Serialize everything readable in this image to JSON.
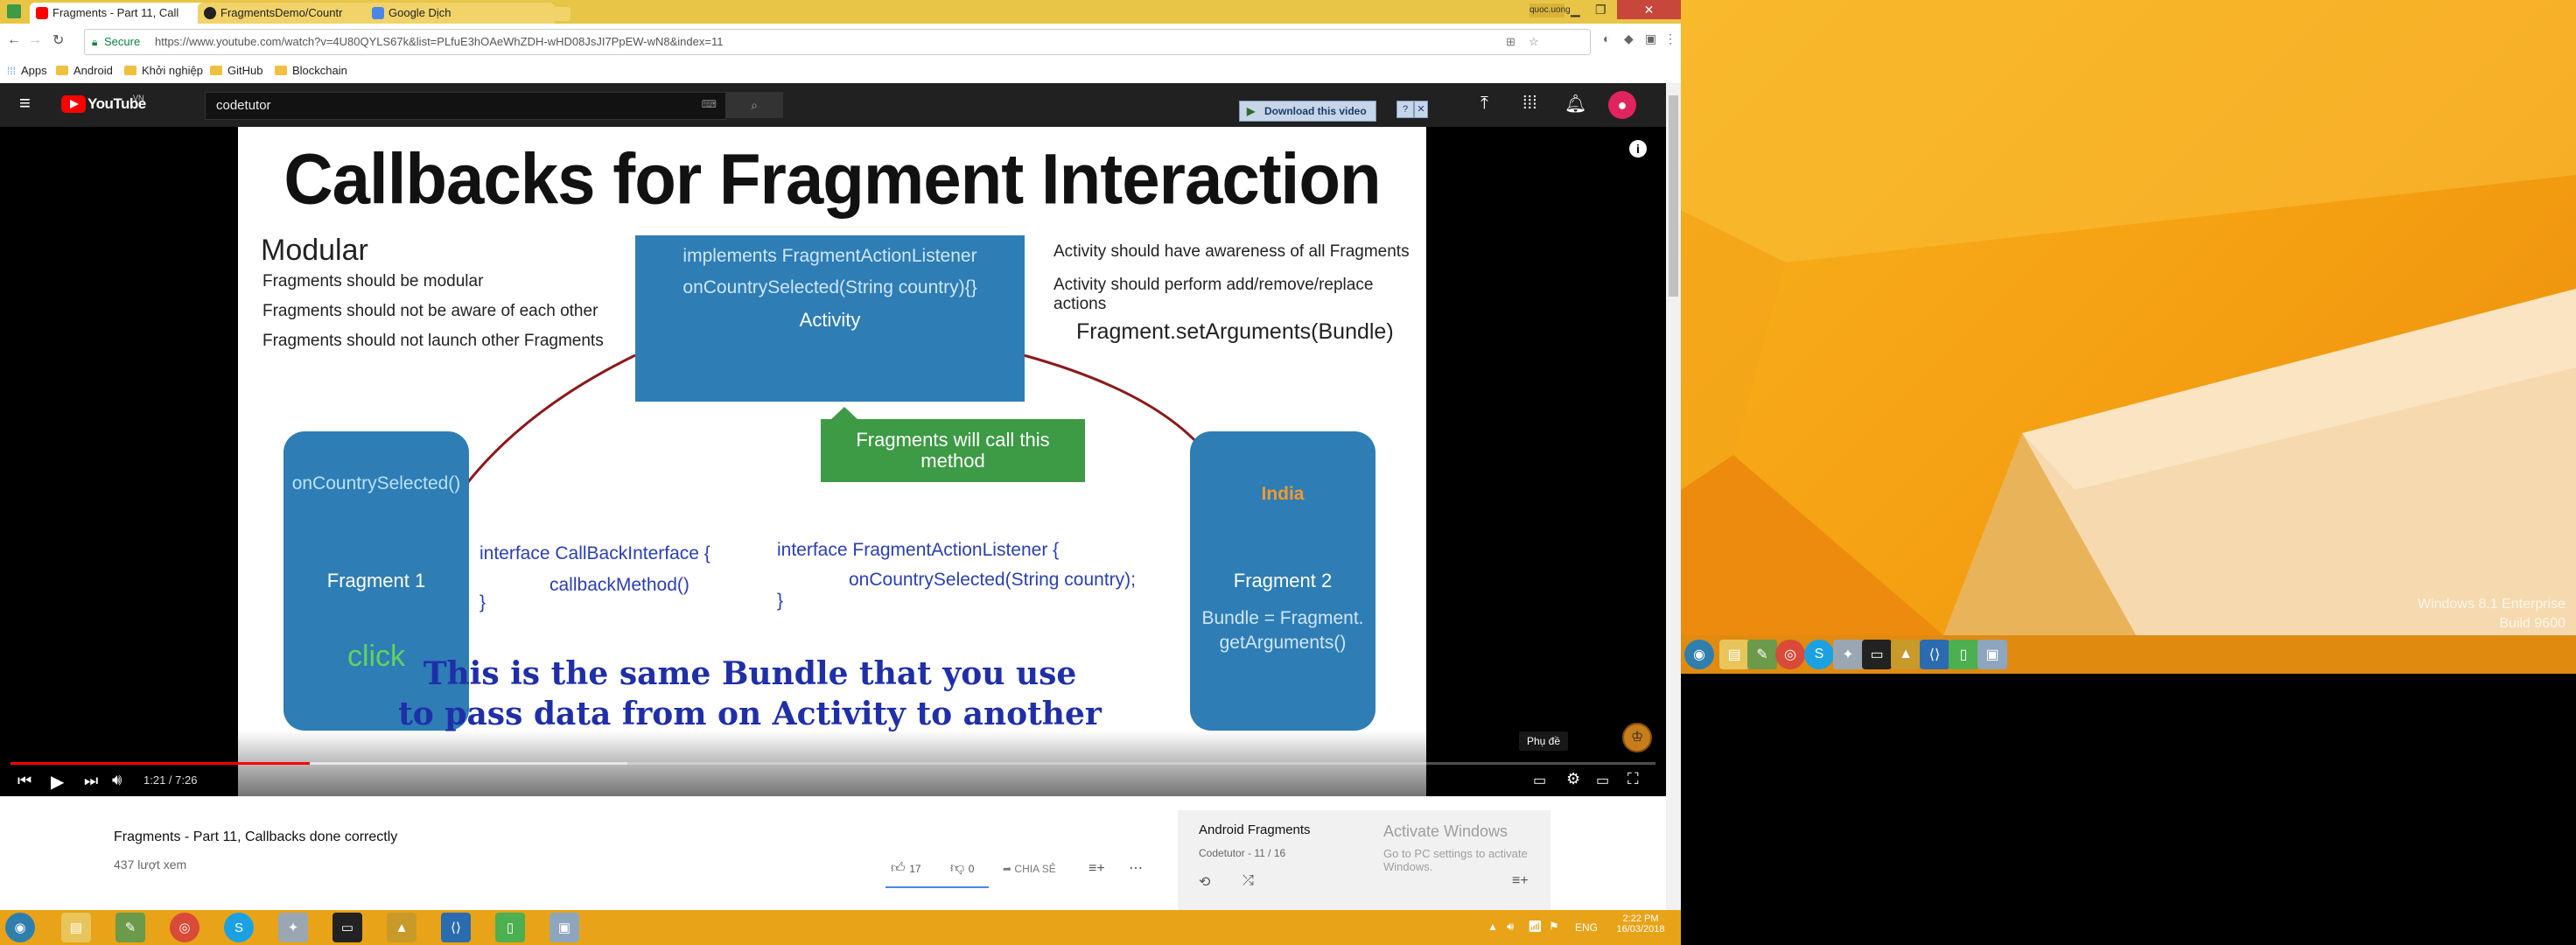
{
  "tabs": [
    {
      "title": "Fragments - Part 11, Call",
      "active": true,
      "icon": "youtube-icon"
    },
    {
      "title": "FragmentsDemo/Countr",
      "active": false,
      "icon": "github-icon"
    },
    {
      "title": "Google Dịch",
      "active": false,
      "icon": "translate-icon"
    }
  ],
  "window_user": "quoc.uong",
  "address": {
    "secure_label": "Secure",
    "url": "https://www.youtube.com/watch?v=4U80QYLS67k&list=PLfuE3hOAeWhZDH-wHD08JsJI7PpEW-wN8&index=11"
  },
  "bookmarks": [
    "Apps",
    "Android",
    "Khởi nghiệp",
    "GitHub",
    "Blockchain"
  ],
  "youtube": {
    "logo": "YouTube",
    "region": "VN",
    "search_value": "codetutor",
    "download_label": "Download this video",
    "video": {
      "time_current": "1:21",
      "time_total": "7:26",
      "progress": 0.182,
      "buffered": 0.375,
      "subtitle_label": "Phụ đề",
      "title": "Fragments - Part 11, Callbacks done correctly",
      "views": "437 lượt xem",
      "likes": "17",
      "dislikes": "0",
      "share_label": "CHIA SẺ"
    },
    "playlist": {
      "title": "Android Fragments",
      "meta": "Codetutor - 11 / 16"
    },
    "activation": {
      "title": "Activate Windows",
      "subtitle": "Go to PC settings to activate Windows."
    }
  },
  "slide": {
    "title": "Callbacks for Fragment Interaction",
    "modular_heading": "Modular",
    "modular_points": [
      "Fragments should be modular",
      "Fragments should not be aware of each other",
      "Fragments should not launch other Fragments"
    ],
    "activity_box": [
      "implements FragmentActionListener",
      "onCountrySelected(String country){}",
      "Activity"
    ],
    "activity_points": [
      "Activity should have awareness of  all Fragments",
      "Activity should perform add/remove/replace actions"
    ],
    "set_arguments": "Fragment.setArguments(Bundle)",
    "callout": "Fragments will call this method",
    "fragment1": {
      "method": "onCountrySelected()",
      "name": "Fragment 1",
      "click": "click"
    },
    "fragment2": {
      "country": "India",
      "name": "Fragment 2",
      "bundle": "Bundle = Fragment. getArguments()"
    },
    "interface1": [
      "interface CallBackInterface {",
      "callbackMethod()",
      "}"
    ],
    "interface2": [
      "interface FragmentActionListener {",
      "onCountrySelected(String country);",
      "}"
    ],
    "bundle_note": [
      "This is the same Bundle that you use",
      "to pass data from on Activity to another"
    ]
  },
  "desktop": {
    "watermark_line1": "Windows 8.1 Enterprise",
    "watermark_line2": "Build 9600"
  },
  "taskbar": {
    "lang": "ENG",
    "time": "2:22 PM",
    "date": "16/03/2018"
  },
  "colors": {
    "slide_blue": "#2e7db5",
    "slide_green": "#3d9a45",
    "yt_red": "#ff0000",
    "taskbar": "#e8a318",
    "chrome_title": "#e8c546"
  }
}
